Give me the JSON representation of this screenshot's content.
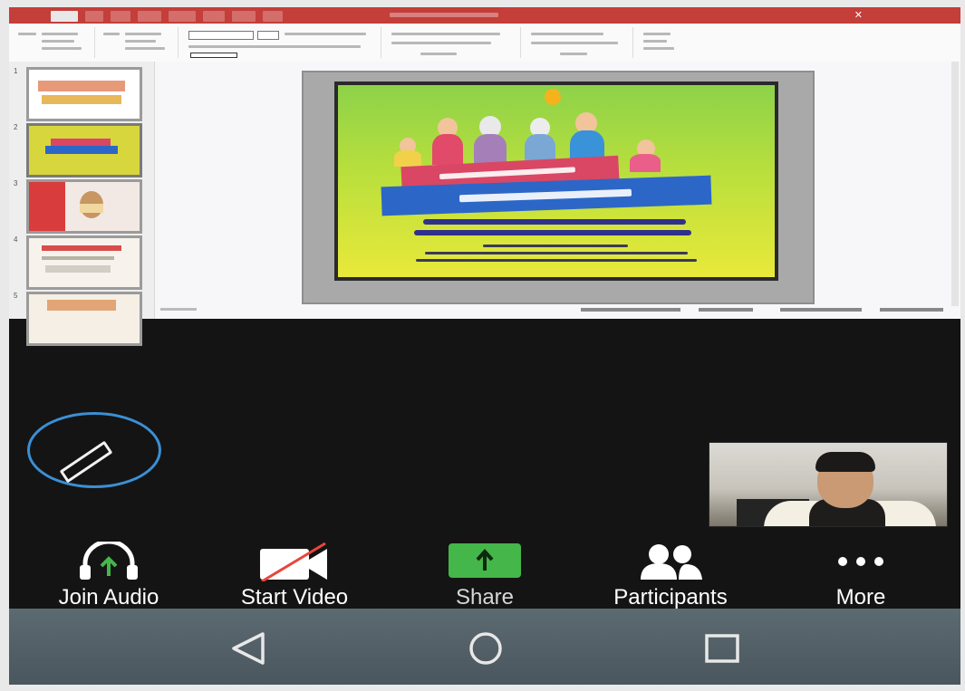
{
  "toolbar": {
    "join_audio": "Join Audio",
    "start_video": "Start Video",
    "share": "Share",
    "participants": "Participants",
    "more": "More"
  },
  "navigation": {
    "back_icon": "back-triangle-icon",
    "home_icon": "home-circle-icon",
    "recents_icon": "recents-square-icon"
  },
  "presentation": {
    "thumbnails": [
      "1",
      "2",
      "3",
      "4",
      "5"
    ]
  },
  "colors": {
    "accent_blue": "#3c8fd4",
    "share_green": "#45b649",
    "ppt_red": "#c43e3a"
  }
}
